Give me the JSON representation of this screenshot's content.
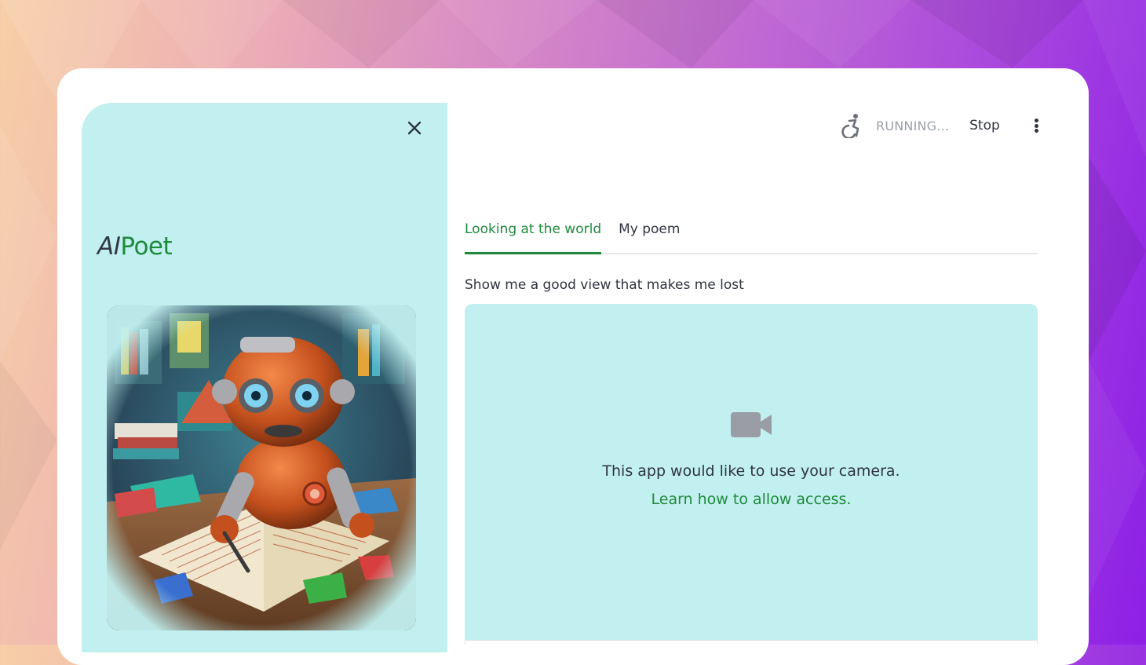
{
  "topbar": {
    "status_label": "RUNNING...",
    "stop_label": "Stop",
    "running_icon": "running-figure-icon",
    "menu_icon": "kebab-menu-icon"
  },
  "sidebar": {
    "close_icon": "close-icon",
    "brand": {
      "prefix": "AI",
      "name": "Poet"
    },
    "illustration": "robot-writing-poem-illustration"
  },
  "main": {
    "tabs": [
      {
        "label": "Looking at the world",
        "active": true
      },
      {
        "label": "My poem",
        "active": false
      }
    ],
    "prompt": "Show me a good view that makes me lost",
    "camera": {
      "icon": "video-camera-icon",
      "message": "This app would like to use your camera.",
      "link": "Learn how to allow access."
    }
  },
  "colors": {
    "accent_green": "#1e8a3c",
    "panel_cyan": "#c2f0f0",
    "text_dark": "#2f3440",
    "muted_gray": "#9aa0a8"
  }
}
